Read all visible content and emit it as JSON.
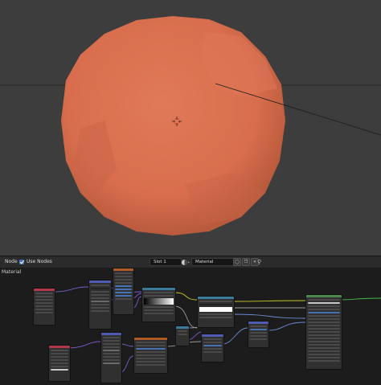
{
  "header": {
    "editor_type": "Node",
    "use_nodes_label": "Use Nodes",
    "use_nodes_checked": true,
    "slot": "Slot 1",
    "material_name": "Material"
  },
  "node_editor": {
    "breadcrumb": "Material"
  },
  "colors": {
    "viewport_bg": "#3d3d3d",
    "sphere": "#d9704f",
    "node_bg": "#303030",
    "header_bg": "#2b2b2b",
    "accent": "#4772b3"
  },
  "icons": [
    "checkbox-icon",
    "material-sphere-icon",
    "shield-icon",
    "copy-icon",
    "delete-icon",
    "pin-icon",
    "cursor-icon"
  ]
}
